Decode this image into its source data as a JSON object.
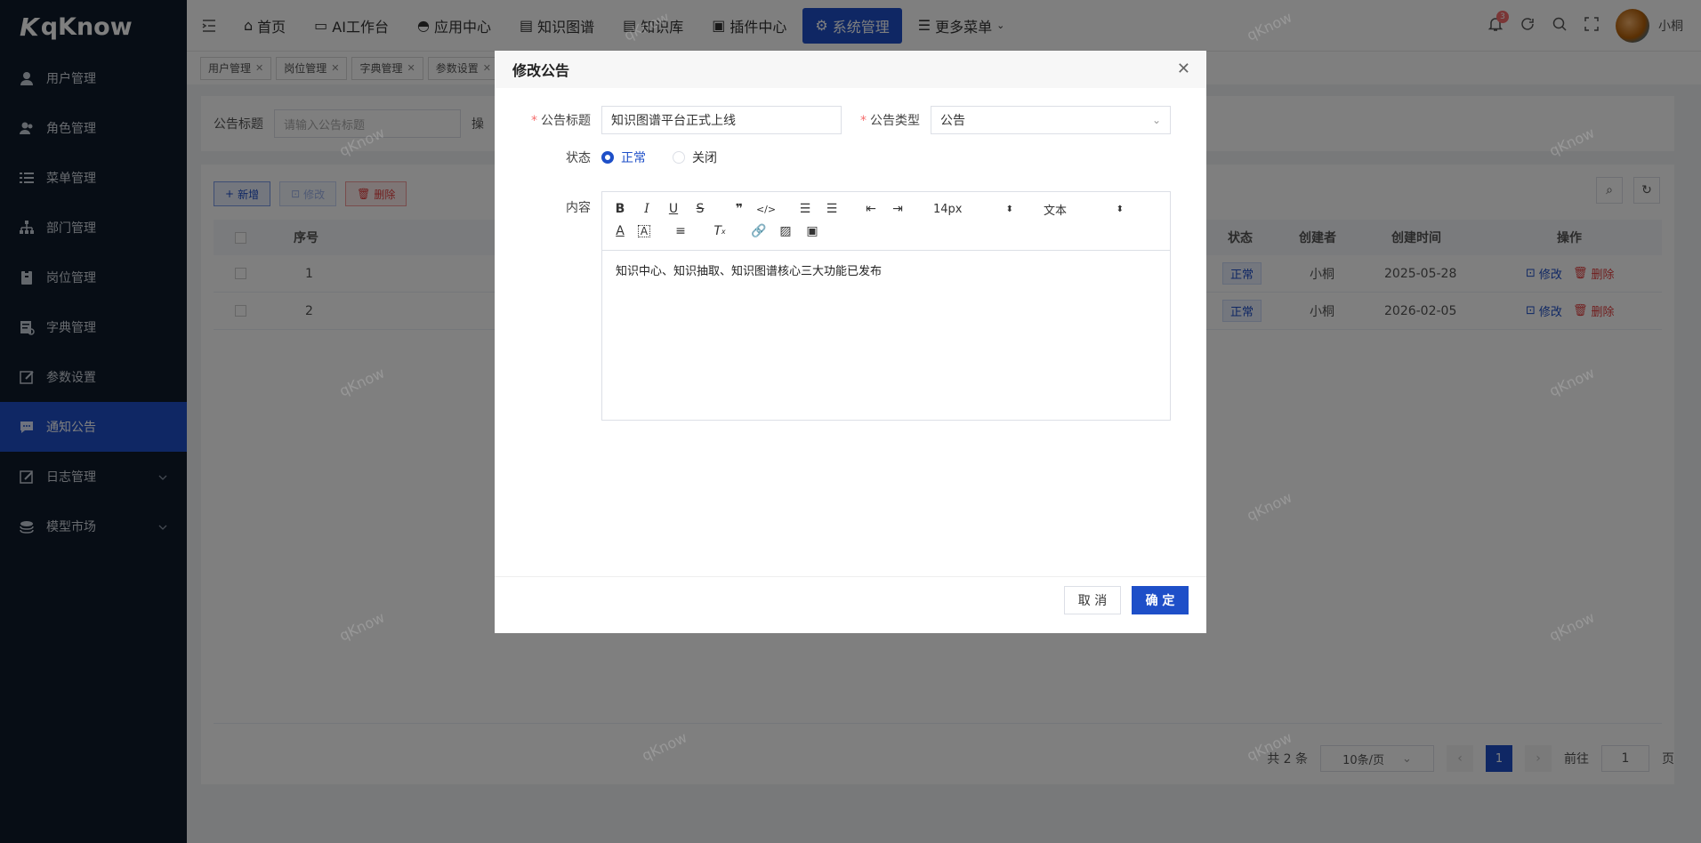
{
  "app": {
    "logo_text": "qKnow"
  },
  "sidebar": {
    "items": [
      {
        "label": "用户管理",
        "icon": "user-icon"
      },
      {
        "label": "角色管理",
        "icon": "users-icon"
      },
      {
        "label": "菜单管理",
        "icon": "menu-list-icon"
      },
      {
        "label": "部门管理",
        "icon": "org-tree-icon"
      },
      {
        "label": "岗位管理",
        "icon": "badge-icon"
      },
      {
        "label": "字典管理",
        "icon": "dictionary-icon"
      },
      {
        "label": "参数设置",
        "icon": "edit-icon"
      },
      {
        "label": "通知公告",
        "icon": "message-icon",
        "active": true
      },
      {
        "label": "日志管理",
        "icon": "log-icon"
      },
      {
        "label": "模型市场",
        "icon": "model-icon"
      }
    ]
  },
  "header": {
    "nav": [
      {
        "label": "首页"
      },
      {
        "label": "AI工作台"
      },
      {
        "label": "应用中心"
      },
      {
        "label": "知识图谱"
      },
      {
        "label": "知识库"
      },
      {
        "label": "插件中心"
      },
      {
        "label": "系统管理",
        "active": true
      },
      {
        "label": "更多菜单"
      }
    ],
    "username": "小桐",
    "notification_count": "3"
  },
  "tags": [
    {
      "label": "用户管理"
    },
    {
      "label": "岗位管理"
    },
    {
      "label": "字典管理"
    },
    {
      "label": "参数设置"
    }
  ],
  "search": {
    "label": "公告标题",
    "placeholder": "请输入公告标题",
    "label2_fragment": "操"
  },
  "toolbar": {
    "add": "新增",
    "edit": "修改",
    "delete": "删除"
  },
  "table": {
    "columns": [
      "序号",
      "状态",
      "创建者",
      "创建时间",
      "操作"
    ],
    "rows": [
      {
        "index": "1",
        "status": "正常",
        "creator": "小桐",
        "created": "2025-05-28",
        "edit": "修改",
        "delete": "删除"
      },
      {
        "index": "2",
        "status": "正常",
        "creator": "小桐",
        "created": "2026-02-05",
        "edit": "修改",
        "delete": "删除"
      }
    ]
  },
  "pager": {
    "total": "共 2 条",
    "page_size": "10条/页",
    "current": "1",
    "goto_label": "前往",
    "goto_value": "1",
    "page_suffix": "页"
  },
  "dialog": {
    "title": "修改公告",
    "fields": {
      "title_label": "公告标题",
      "title_value": "知识图谱平台正式上线",
      "type_label": "公告类型",
      "type_value": "公告",
      "status_label": "状态",
      "status_options": [
        "正常",
        "关闭"
      ],
      "content_label": "内容"
    },
    "editor": {
      "font_size": "14px",
      "block_type": "文本",
      "content": "知识中心、知识抽取、知识图谱核心三大功能已发布"
    },
    "cancel": "取 消",
    "confirm": "确 定"
  },
  "watermark": "qKnow"
}
